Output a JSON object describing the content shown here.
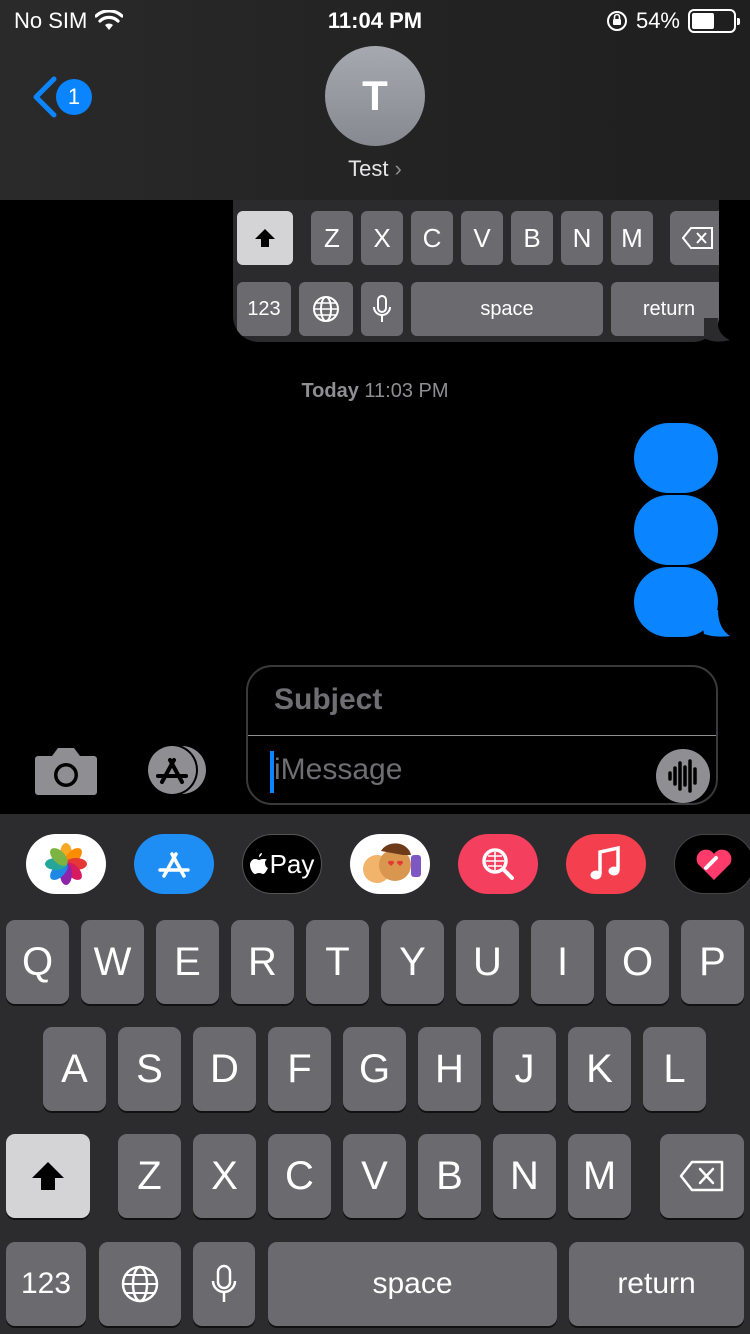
{
  "status_bar": {
    "carrier": "No SIM",
    "time": "11:04 PM",
    "battery": "54%",
    "battery_level": 0.54
  },
  "header": {
    "back_badge": "1",
    "avatar_letter": "T",
    "contact_name": "Test",
    "chevron": "›"
  },
  "thread": {
    "timestamp_day": "Today",
    "timestamp_time": "11:03 PM",
    "attachment_keyboard": {
      "row3": [
        "Z",
        "X",
        "C",
        "V",
        "B",
        "N",
        "M"
      ],
      "num_label": "123",
      "space_label": "space",
      "return_label": "return"
    }
  },
  "composer": {
    "subject_placeholder": "Subject",
    "message_placeholder": "iMessage"
  },
  "app_drawer": {
    "apps": [
      "photos-app-icon",
      "app-store-icon",
      "apple-pay-icon",
      "memoji-icon",
      "search-images-icon",
      "music-icon",
      "digital-touch-icon"
    ],
    "apple_pay_label": "Pay"
  },
  "keyboard": {
    "row1": [
      "Q",
      "W",
      "E",
      "R",
      "T",
      "Y",
      "U",
      "I",
      "O",
      "P"
    ],
    "row2": [
      "A",
      "S",
      "D",
      "F",
      "G",
      "H",
      "J",
      "K",
      "L"
    ],
    "row3": [
      "Z",
      "X",
      "C",
      "V",
      "B",
      "N",
      "M"
    ],
    "num_label": "123",
    "space_label": "space",
    "return_label": "return"
  },
  "colors": {
    "accent": "#0a84ff",
    "key": "#6b6b6f",
    "key_light": "#d4d4d6",
    "keyboard_bg": "#2c2c2e"
  }
}
